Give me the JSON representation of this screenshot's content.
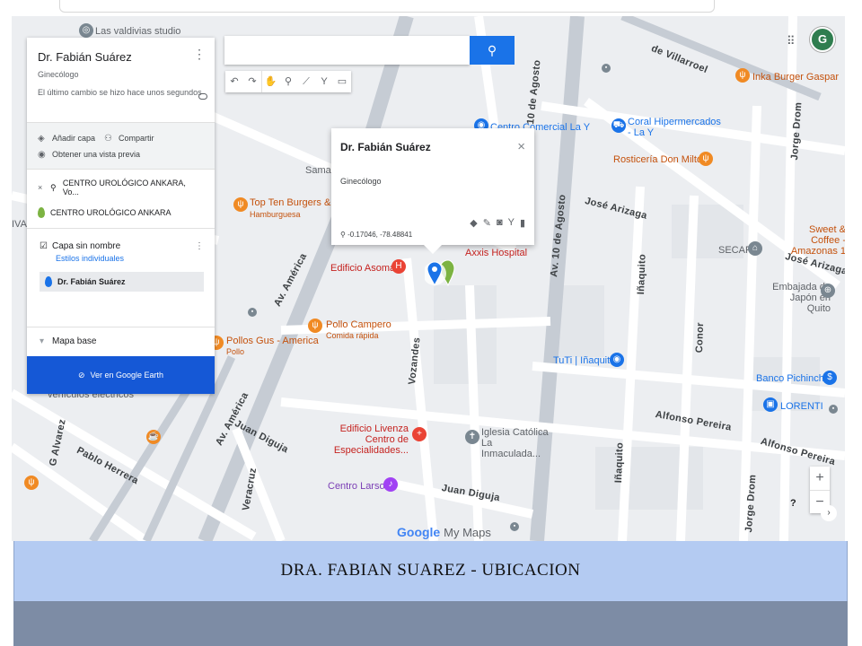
{
  "map": {
    "search_placeholder": "",
    "streets": {
      "av_10_agosto": "Av. 10 de Agosto",
      "av_america": "Av. América",
      "av_america_2": "Av. América",
      "vozandes": "Vozandes",
      "inaquito": "Iñaquito",
      "jose_arizaga": "José Arizaga",
      "jose_arizaga_2": "José Arizaga",
      "alfonso_pereira": "Alfonso Pereira",
      "alfonso_pereira_2": "Alfonso Pereira",
      "juan_diguja": "Juan Diguja",
      "juan_diguja_2": "Juan Diguja",
      "pablo_herrera": "Pablo Herrera",
      "conor": "Conor",
      "jorge_drom": "Jorge Drom",
      "jorge_drom_2": "Jorge Drom",
      "veracruz": "Veracruz",
      "villarroel": "de Villarroel",
      "g_alvarez": "G Alvarez"
    },
    "places": {
      "las_valdivias": "Las valdivias studio",
      "centro_comercial": "Centro Comercial La Y",
      "coral": "Coral Hipermercados - La Y",
      "inka_burger": "Inka Burger Gaspar",
      "rosticeria": "Rosticería Don Milton",
      "top_ten": "Top Ten Burgers & Fri",
      "top_ten_sub": "Hamburguesa",
      "edificio_asoma": "Edificio Asoma",
      "axxis": "Axxis Hospital",
      "pollo_campero": "Pollo Campero",
      "pollo_campero_sub": "Comida rápida",
      "pollos_gus": "Pollos Gus - America",
      "pollos_gus_sub": "Pollo",
      "secap": "SECAP",
      "sweet_coffee": "Sweet & Coffee - Amazonas 1",
      "embajada": "Embajada de Japón en Quito",
      "tuti": "TuTi | Iñaquito",
      "banco_pichincha": "Banco Pichincha",
      "lorenti": "LORENTI",
      "edificio_livenza": "Edificio Livenza Centro de Especialidades...",
      "iglesia": "Iglesia Católica La Inmaculada...",
      "centro_larson": "Centro Larson",
      "vehiculos": "vehículos eléctricos",
      "samad": "Samad",
      "iva": "IVA"
    },
    "logo_google": "Google",
    "logo_mymaps": "My Maps"
  },
  "side_panel": {
    "title": "Dr. Fabián Suárez",
    "subtitle": "Ginecólogo",
    "last_change": "El último cambio se hizo hace unos segundos",
    "add_layer": "Añadir capa",
    "share": "Compartir",
    "preview": "Obtener una vista previa",
    "search_result": "CENTRO UROLÓGICO ANKARA, Vo...",
    "result_item": "CENTRO UROLÓGICO ANKARA",
    "layer_name": "Capa sin nombre",
    "layer_style": "Estilos individuales",
    "layer_item": "Dr. Fabián Suárez",
    "base_map": "Mapa base",
    "earth_button": "Ver en Google Earth"
  },
  "popup": {
    "title": "Dr. Fabián Suárez",
    "subtitle": "Ginecólogo",
    "coords": "-0.17046, -78.48841"
  },
  "avatar_letter": "G",
  "caption": "DRA. FABIAN  SUAREZ  -  UBICACION",
  "colors": {
    "caption_band": "#b4cbf2",
    "footer_band": "#7d8ca5",
    "earth_button": "#1558d6",
    "search_button": "#1a73e8",
    "marker_blue": "#1a73e8",
    "marker_green": "#7cb342"
  }
}
